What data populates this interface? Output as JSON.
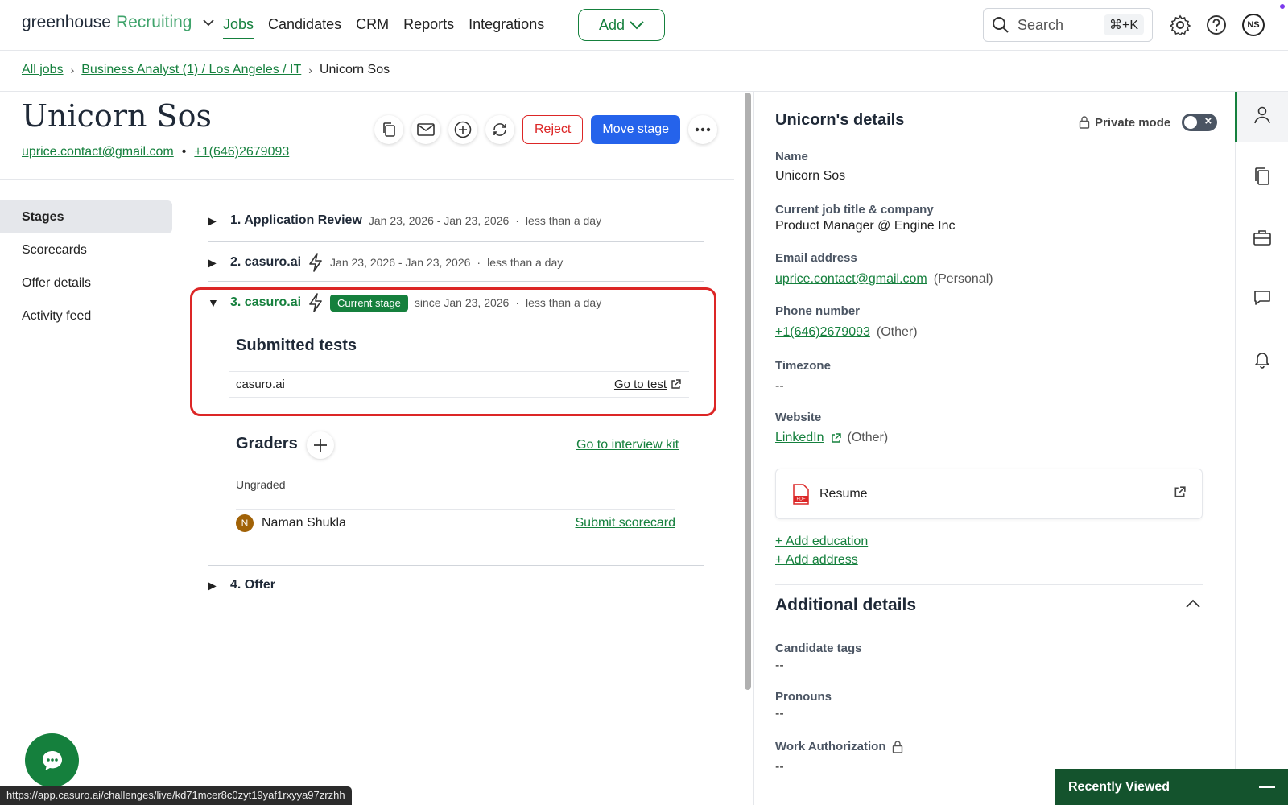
{
  "nav": {
    "logo_main": "greenhouse",
    "logo_sub": "Recruiting",
    "links": [
      "Jobs",
      "Candidates",
      "CRM",
      "Reports",
      "Integrations"
    ],
    "add_label": "Add",
    "search_placeholder": "Search",
    "search_shortcut": "⌘+K",
    "avatar_initials": "NS"
  },
  "breadcrumb": {
    "all_jobs": "All jobs",
    "job": "Business Analyst (1) / Los Angeles / IT",
    "current": "Unicorn Sos"
  },
  "candidate": {
    "name": "Unicorn Sos",
    "email": "uprice.contact@gmail.com",
    "phone": "+1(646)2679093",
    "reject_label": "Reject",
    "move_stage_label": "Move stage"
  },
  "sidenav": [
    "Stages",
    "Scorecards",
    "Offer details",
    "Activity feed"
  ],
  "stages": [
    {
      "name": "1. Application Review",
      "dates": "Jan 23, 2026 - Jan 23, 2026",
      "duration": "less than a day"
    },
    {
      "name": "2. casuro.ai",
      "dates": "Jan 23, 2026 - Jan 23, 2026",
      "duration": "less than a day"
    },
    {
      "name": "3. casuro.ai",
      "badge": "Current stage",
      "dates": "since Jan 23, 2026",
      "duration": "less than a day"
    },
    {
      "name": "4. Offer"
    }
  ],
  "submitted_tests": {
    "title": "Submitted tests",
    "test_name": "casuro.ai",
    "go_label": "Go to test"
  },
  "graders": {
    "title": "Graders",
    "interview_kit": "Go to interview kit",
    "status": "Ungraded",
    "grader_initial": "N",
    "grader_name": "Naman Shukla",
    "submit_label": "Submit scorecard"
  },
  "details": {
    "title": "Unicorn's details",
    "private_mode": "Private mode",
    "name_label": "Name",
    "name": "Unicorn Sos",
    "job_label": "Current job title & company",
    "job": "Product Manager @ Engine Inc",
    "email_label": "Email address",
    "email": "uprice.contact@gmail.com",
    "email_type": "(Personal)",
    "phone_label": "Phone number",
    "phone": "+1(646)2679093",
    "phone_type": "(Other)",
    "tz_label": "Timezone",
    "tz": "--",
    "website_label": "Website",
    "website": "LinkedIn",
    "website_type": "(Other)",
    "resume": "Resume",
    "add_education": "+ Add education",
    "add_address": "+ Add address",
    "additional_title": "Additional details",
    "tags_label": "Candidate tags",
    "tags": "--",
    "pronouns_label": "Pronouns",
    "pronouns": "--",
    "work_auth_label": "Work Authorization",
    "work_auth": "--"
  },
  "recently_viewed": "Recently Viewed",
  "status_url": "https://app.casuro.ai/challenges/live/kd71mcer8c0zyt19yaf1rxyya97zrzhh",
  "colors": {
    "brand_green": "#15803d",
    "primary_blue": "#2563eb",
    "reject_red": "#dc2626"
  }
}
